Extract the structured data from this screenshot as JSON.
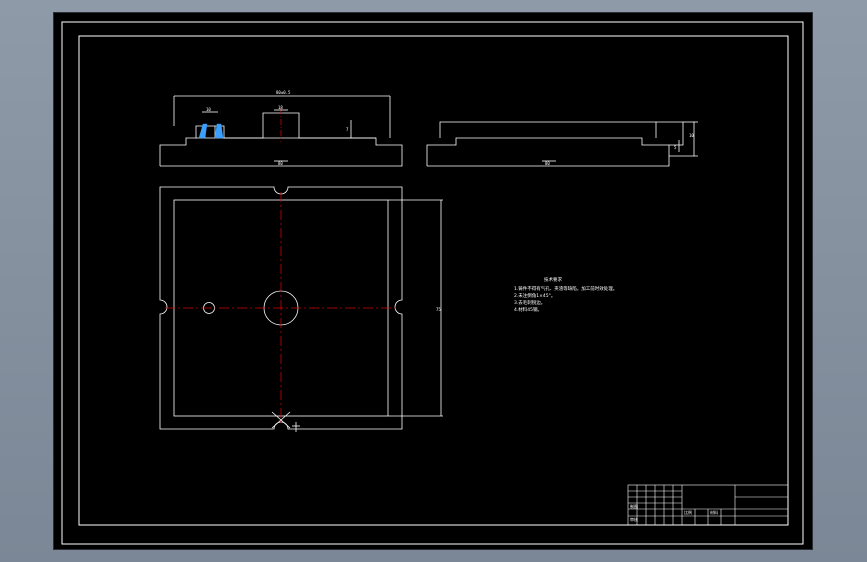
{
  "drawing": {
    "line_color": "#ffffff",
    "centerline_color": "#d40000",
    "background_color": "#000000"
  },
  "dimensions": {
    "front_overall_width": "80±0.5",
    "front_slot_width": "10",
    "front_boss_width": "18",
    "front_height": "7",
    "front_base_width": "80",
    "side_base_width": "80",
    "side_height": "10",
    "side_step": "5",
    "plan_height": "75"
  },
  "notes": {
    "title": "技术要求",
    "lines": [
      "1.铸件不得有气孔、夹渣等缺陷，加工前时效处理。",
      "2.未注倒角1×45°。",
      "3.去毛刺锐边。",
      "4.材料45钢。"
    ]
  },
  "title_block": {
    "label_scale": "比例",
    "label_material": "材料",
    "label_drawing": "制图",
    "label_check": "审核"
  }
}
